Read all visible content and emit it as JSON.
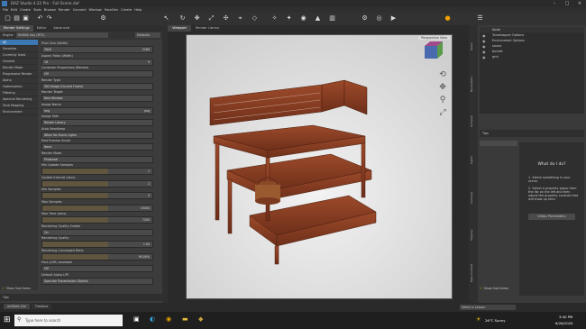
{
  "title": "DAZ Studio 4.22 Pro - Full Scene.duf",
  "menu": [
    "File",
    "Edit",
    "Create",
    "Tools",
    "Browse",
    "Render",
    "Connect",
    "Window",
    "FaceGen",
    "Create",
    "Help"
  ],
  "left_tabs": [
    "Render Settings",
    "Editor",
    "Advanced"
  ],
  "engine_label": "Engine",
  "engine_value": "NVIDIA Iray (RTX)",
  "preset_label": "Defaults",
  "categories": [
    "All",
    "Favorites",
    "Currently Used",
    "General",
    "Render Mode",
    "Progressive Render",
    "Alpha",
    "Optimization",
    "Filtering",
    "Spectral Rendering",
    "Tone Mapping",
    "Environment"
  ],
  "props": [
    {
      "label": "Pixel Size (Width)",
      "value": "3840",
      "num": "2160"
    },
    {
      "label": "Aspect Ratio (Width)",
      "value": "16",
      "num": "9"
    },
    {
      "label": "Constrain Proportions (Render)",
      "value": "Off"
    },
    {
      "label": "Render Type",
      "value": "Still Image (Current Frame)"
    },
    {
      "label": "Render Target",
      "value": "New Window"
    },
    {
      "label": "Image Name",
      "value": "Img",
      "num": "png"
    },
    {
      "label": "Image Path",
      "value": "Render Library"
    },
    {
      "label": "Auto Headlamp",
      "value": "When No Scene Lights"
    },
    {
      "label": "Post Process Script",
      "value": "None"
    },
    {
      "label": "Render Mode",
      "value": "Photoreal"
    },
    {
      "label": "Min Update Samples",
      "value": "",
      "num": "1"
    },
    {
      "label": "Update Interval (secs)",
      "value": "",
      "num": "2"
    },
    {
      "label": "Min Samples",
      "value": "",
      "num": "5"
    },
    {
      "label": "Max Samples",
      "value": "",
      "num": "15000"
    },
    {
      "label": "Max Time (secs)",
      "value": "",
      "num": "7200"
    },
    {
      "label": "Rendering Quality Enable",
      "value": "On"
    },
    {
      "label": "Rendering Quality",
      "value": "",
      "num": "1.00"
    },
    {
      "label": "Rendering Converged Ratio",
      "value": "",
      "num": "95.00%"
    },
    {
      "label": "Post (LDR) Available",
      "value": "Off"
    },
    {
      "label": "Default Alpha LPE",
      "value": "Specular Transmission Objects"
    }
  ],
  "show_sub_items": "Show Sub Items",
  "tips_label": "Tips",
  "viewport_tabs": [
    "Viewport",
    "Render Library"
  ],
  "camera": "Perspective View",
  "scene_header": "Node",
  "scene_items": [
    "Tonemapper Options",
    "Environment Options",
    "sauna",
    "bucket",
    "grid"
  ],
  "right_vertical_tabs": [
    "Scene",
    "Parameters",
    "Surfaces",
    "Lights",
    "Cameras",
    "Shaping",
    "Pose Controls"
  ],
  "tips_title": "What do I do?",
  "tips_text_1": "1. Select something in your scene.",
  "tips_text_2": "2. Select a property group from the list on the left and then adjust the property controls that will show up here.",
  "tips_button": "Video: Parameters",
  "bottom_tabs": [
    "aniMate Lite",
    "Timeline"
  ],
  "select_lesson": "Select a Lesson",
  "search_placeholder": "Type here to search",
  "weather": "26°C  Sunny",
  "time": "3:40 PM",
  "date": "6/26/2020"
}
